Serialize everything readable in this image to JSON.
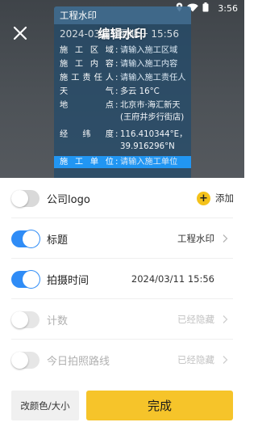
{
  "status_bar": {
    "time": "3:56"
  },
  "header": {
    "title": "编辑水印",
    "close_icon": "close-icon"
  },
  "watermark": {
    "title": "工程水印",
    "datetime": "2024-03-11 星期一 15:56",
    "rows": [
      {
        "key": "施工区域",
        "value": "请输入施工区域"
      },
      {
        "key": "施工内容",
        "value": "请输入施工内容"
      },
      {
        "key": "施工责任人",
        "value": "请输入施工责任人"
      },
      {
        "key": "天气",
        "value": "多云 16°C"
      },
      {
        "key": "地点",
        "value": "北京市·海汇新天(王府井步行街店)"
      },
      {
        "key": "经纬度",
        "value": "116.410344°E，39.916296°N"
      },
      {
        "key": "施工单位",
        "value": "请输入施工单位"
      }
    ]
  },
  "options": [
    {
      "label": "公司logo",
      "enabled": false,
      "action": "添加"
    },
    {
      "label": "标题",
      "enabled": true,
      "value": "工程水印"
    },
    {
      "label": "拍摄时间",
      "enabled": true,
      "value": "2024/03/11 15:56"
    },
    {
      "label": "计数",
      "enabled": false,
      "value": "已经隐藏"
    },
    {
      "label": "今日拍照路线",
      "enabled": false,
      "value": "已经隐藏"
    }
  ],
  "footer": {
    "color_size_label": "改颜色/大小",
    "done_label": "完成"
  },
  "colors": {
    "accent_blue": "#2f8cf6",
    "accent_yellow": "#f6c42a",
    "highlight_row": "#2196f3"
  }
}
